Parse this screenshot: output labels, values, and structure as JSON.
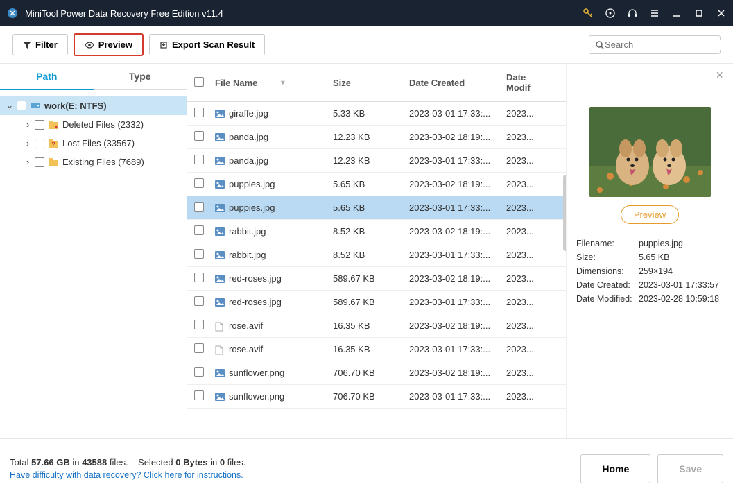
{
  "app": {
    "title": "MiniTool Power Data Recovery Free Edition v11.4"
  },
  "toolbar": {
    "filter": "Filter",
    "preview": "Preview",
    "export": "Export Scan Result",
    "search_placeholder": "Search"
  },
  "tabs": {
    "path": "Path",
    "type": "Type"
  },
  "tree": {
    "root": "work(E: NTFS)",
    "items": [
      {
        "label": "Deleted Files (2332)"
      },
      {
        "label": "Lost Files (33567)"
      },
      {
        "label": "Existing Files (7689)"
      }
    ]
  },
  "columns": {
    "name": "File Name",
    "size": "Size",
    "created": "Date Created",
    "modified": "Date Modif"
  },
  "files": [
    {
      "name": "giraffe.jpg",
      "size": "5.33 KB",
      "created": "2023-03-01 17:33:...",
      "modified": "2023..."
    },
    {
      "name": "panda.jpg",
      "size": "12.23 KB",
      "created": "2023-03-02 18:19:...",
      "modified": "2023..."
    },
    {
      "name": "panda.jpg",
      "size": "12.23 KB",
      "created": "2023-03-01 17:33:...",
      "modified": "2023..."
    },
    {
      "name": "puppies.jpg",
      "size": "5.65 KB",
      "created": "2023-03-02 18:19:...",
      "modified": "2023..."
    },
    {
      "name": "puppies.jpg",
      "size": "5.65 KB",
      "created": "2023-03-01 17:33:...",
      "modified": "2023...",
      "selected": true
    },
    {
      "name": "rabbit.jpg",
      "size": "8.52 KB",
      "created": "2023-03-02 18:19:...",
      "modified": "2023..."
    },
    {
      "name": "rabbit.jpg",
      "size": "8.52 KB",
      "created": "2023-03-01 17:33:...",
      "modified": "2023..."
    },
    {
      "name": "red-roses.jpg",
      "size": "589.67 KB",
      "created": "2023-03-02 18:19:...",
      "modified": "2023..."
    },
    {
      "name": "red-roses.jpg",
      "size": "589.67 KB",
      "created": "2023-03-01 17:33:...",
      "modified": "2023..."
    },
    {
      "name": "rose.avif",
      "size": "16.35 KB",
      "created": "2023-03-02 18:19:...",
      "modified": "2023...",
      "blank_icon": true
    },
    {
      "name": "rose.avif",
      "size": "16.35 KB",
      "created": "2023-03-01 17:33:...",
      "modified": "2023...",
      "blank_icon": true
    },
    {
      "name": "sunflower.png",
      "size": "706.70 KB",
      "created": "2023-03-02 18:19:...",
      "modified": "2023..."
    },
    {
      "name": "sunflower.png",
      "size": "706.70 KB",
      "created": "2023-03-01 17:33:...",
      "modified": "2023..."
    }
  ],
  "preview": {
    "button": "Preview",
    "meta": {
      "filename_label": "Filename:",
      "filename": "puppies.jpg",
      "size_label": "Size:",
      "size": "5.65 KB",
      "dimensions_label": "Dimensions:",
      "dimensions": "259×194",
      "created_label": "Date Created:",
      "created": "2023-03-01 17:33:57",
      "modified_label": "Date Modified:",
      "modified": "2023-02-28 10:59:18"
    }
  },
  "footer": {
    "total_pre": "Total ",
    "total_size": "57.66 GB",
    "in1": " in ",
    "total_files": "43588",
    "files_txt": " files.",
    "sel_pre": "Selected ",
    "sel_bytes": "0 Bytes",
    "in2": " in ",
    "sel_files": "0",
    "files_txt2": " files.",
    "help": "Have difficulty with data recovery? Click here for instructions.",
    "home": "Home",
    "save": "Save"
  }
}
